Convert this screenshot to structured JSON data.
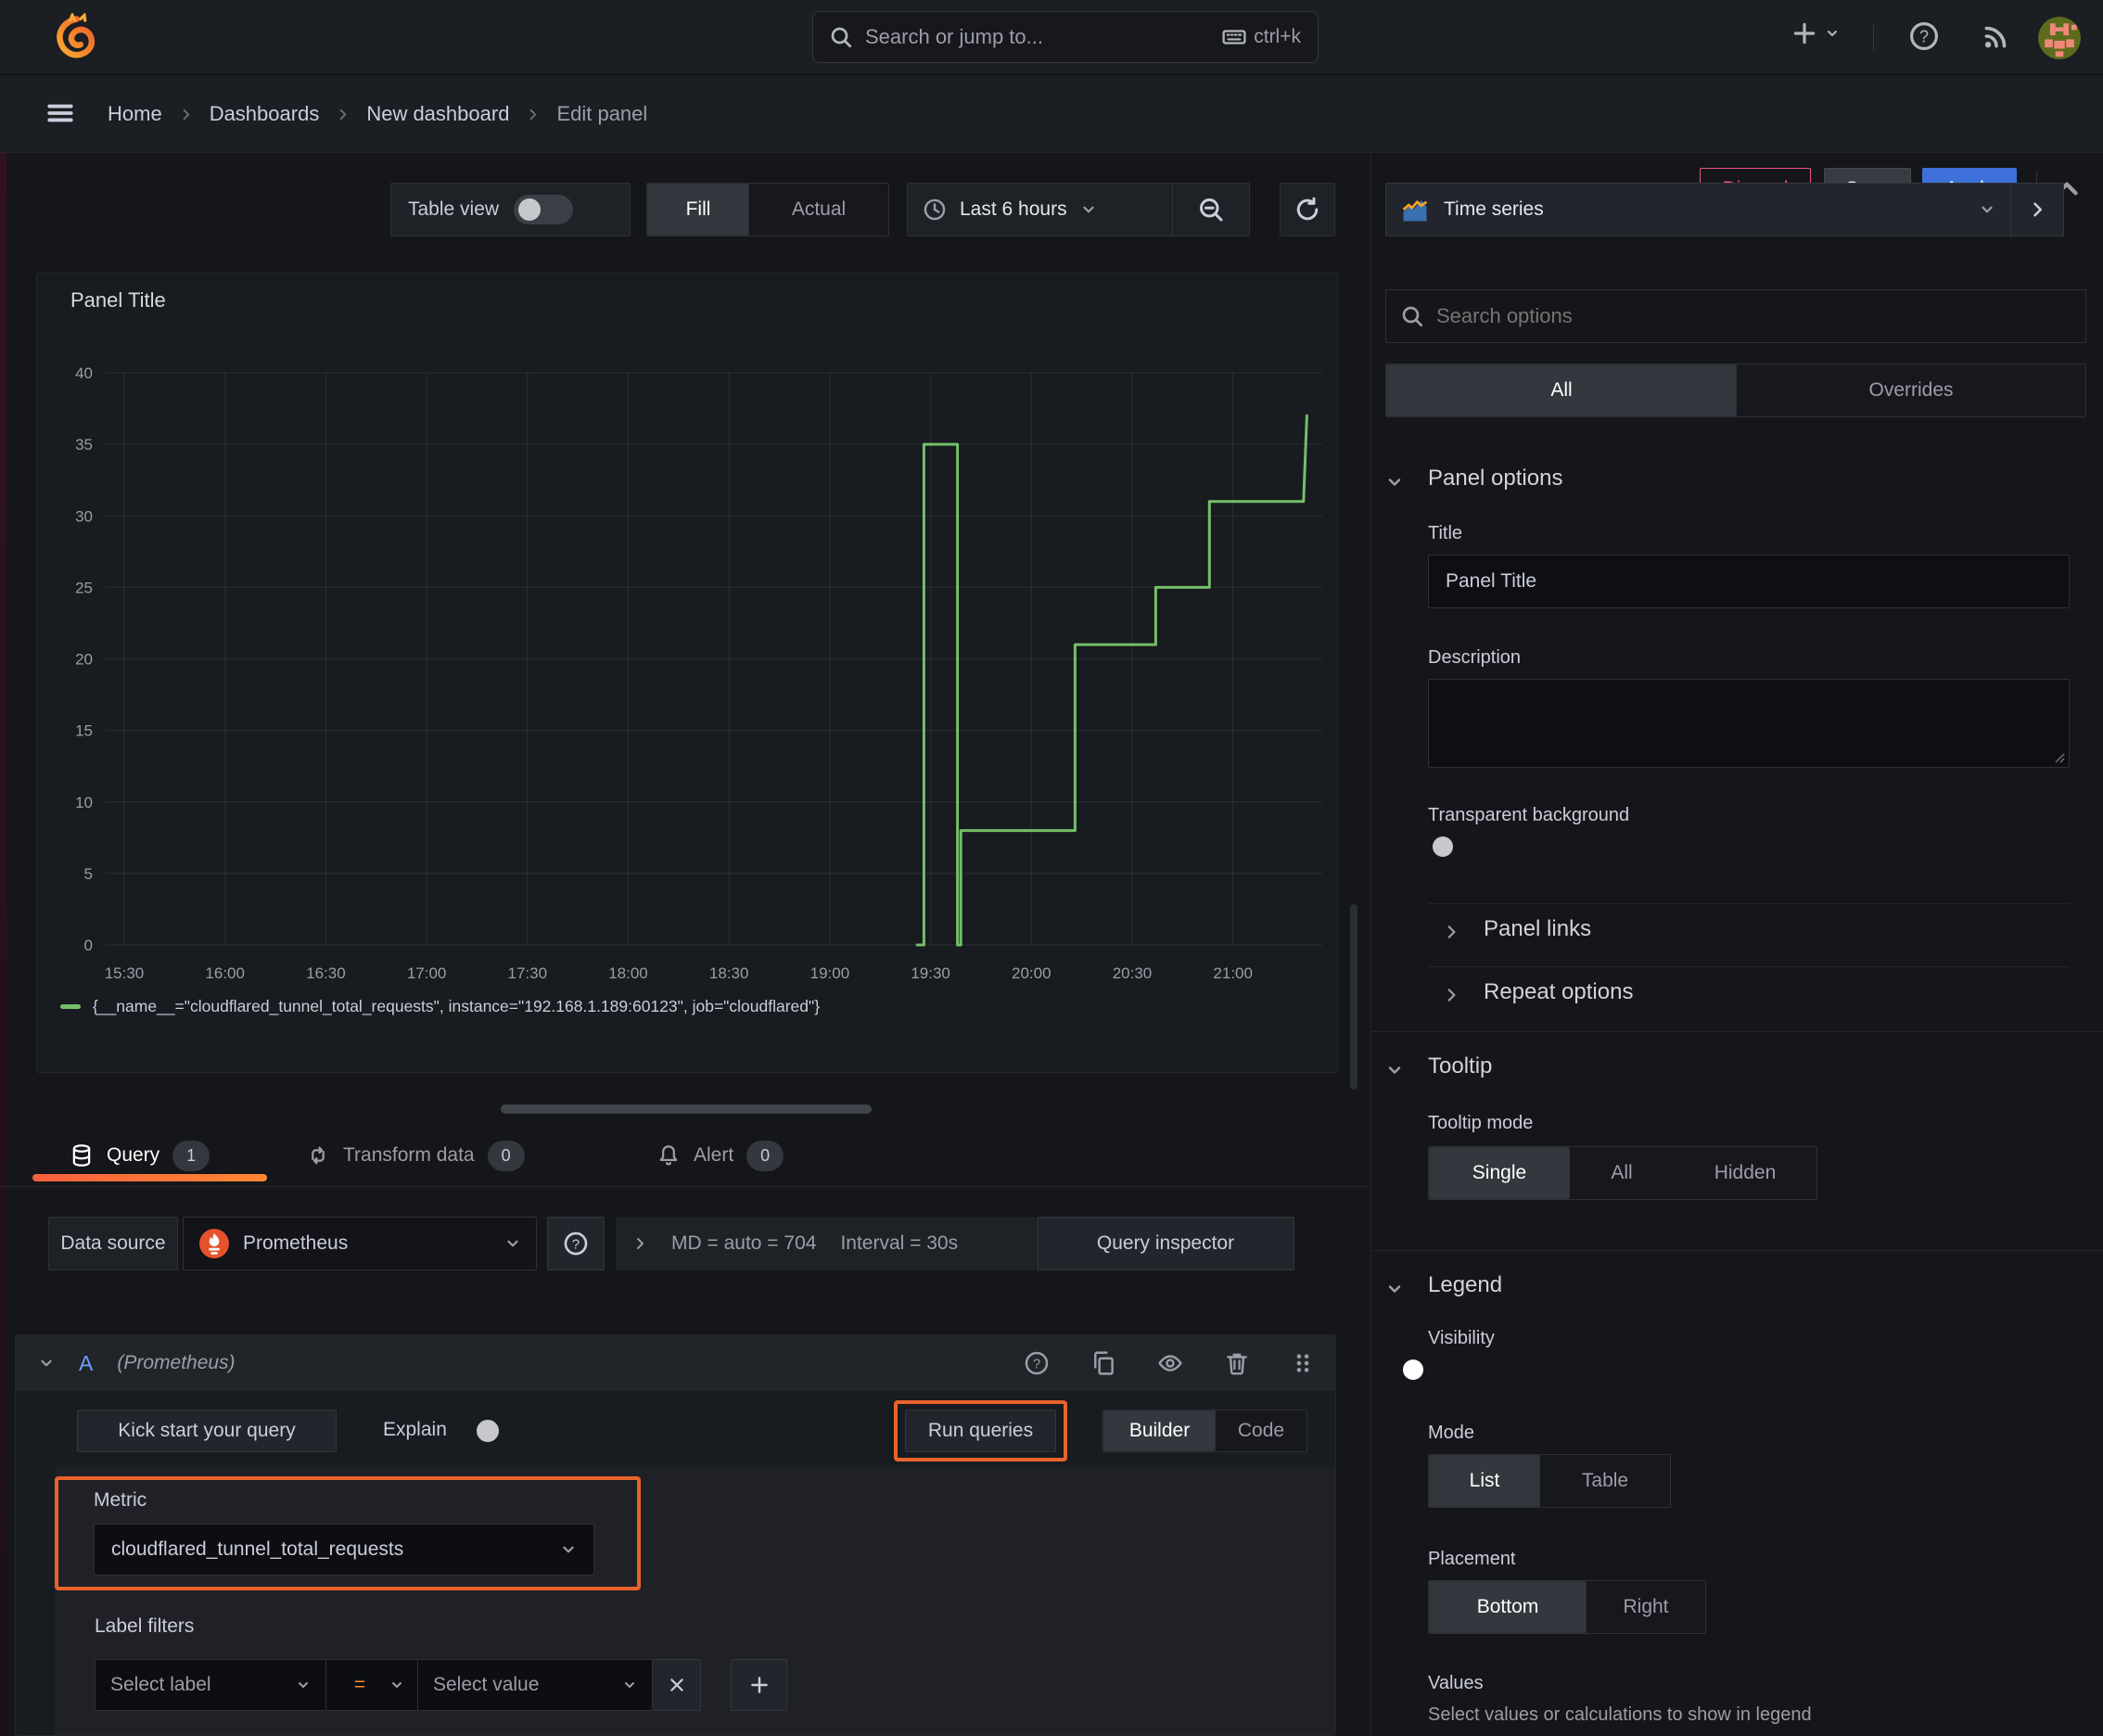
{
  "colors": {
    "accent_orange": "#e8632b",
    "tab_underline_from": "#f55f3e",
    "tab_underline_to": "#ff8833",
    "apply_blue": "#3d71d9",
    "discard_pink": "#f0517f",
    "series_green": "#73bf69",
    "toggle_on_blue": "#3d71d9"
  },
  "nav": {
    "search_placeholder": "Search or jump to...",
    "shortcut": "ctrl+k"
  },
  "breadcrumb": {
    "items": [
      "Home",
      "Dashboards",
      "New dashboard",
      "Edit panel"
    ]
  },
  "actions": {
    "discard": "Discard",
    "save": "Save",
    "apply": "Apply"
  },
  "toolbar": {
    "table_view": "Table view",
    "fill": "Fill",
    "actual": "Actual",
    "time_range": "Last 6 hours"
  },
  "viz_picker": {
    "name": "Time series"
  },
  "panel": {
    "title": "Panel Title"
  },
  "chart_data": {
    "type": "line",
    "step": true,
    "title": "Panel Title",
    "x_ticks": [
      "15:30",
      "16:00",
      "16:30",
      "17:00",
      "17:30",
      "18:00",
      "18:30",
      "19:00",
      "19:30",
      "20:00",
      "20:30",
      "21:00"
    ],
    "y_ticks": [
      0,
      5,
      10,
      15,
      20,
      25,
      30,
      35,
      40
    ],
    "ylim": [
      0,
      40
    ],
    "grid": true,
    "legend_position": "bottom",
    "series": [
      {
        "name": "{__name__=\"cloudflared_tunnel_total_requests\", instance=\"192.168.1.189:60123\", job=\"cloudflared\"}",
        "color": "#73bf69",
        "points": [
          [
            "19:26",
            0
          ],
          [
            "19:28",
            0
          ],
          [
            "19:28",
            35
          ],
          [
            "19:38",
            35
          ],
          [
            "19:38",
            0
          ],
          [
            "19:39",
            0
          ],
          [
            "19:39",
            8
          ],
          [
            "20:13",
            8
          ],
          [
            "20:13",
            21
          ],
          [
            "20:37",
            21
          ],
          [
            "20:37",
            25
          ],
          [
            "20:53",
            25
          ],
          [
            "20:53",
            31
          ],
          [
            "21:21",
            31
          ],
          [
            "21:22",
            37
          ]
        ]
      }
    ]
  },
  "querybar": {
    "tabs": [
      {
        "label": "Query",
        "count": "1"
      },
      {
        "label": "Transform data",
        "count": "0"
      },
      {
        "label": "Alert",
        "count": "0"
      }
    ]
  },
  "datasource": {
    "label": "Data source",
    "name": "Prometheus",
    "stats_md": "MD = auto = 704",
    "stats_interval": "Interval = 30s",
    "inspector": "Query inspector"
  },
  "query": {
    "ref": "A",
    "ds": "(Prometheus)",
    "kickstart": "Kick start your query",
    "explain": "Explain",
    "run": "Run queries",
    "mode_builder": "Builder",
    "mode_code": "Code",
    "metric_label": "Metric",
    "metric": "cloudflared_tunnel_total_requests",
    "label_filters": "Label filters",
    "select_label": "Select label",
    "op": "=",
    "select_value": "Select value"
  },
  "options": {
    "search_placeholder": "Search options",
    "tab_all": "All",
    "tab_overrides": "Overrides",
    "panel_options": {
      "header": "Panel options",
      "title_label": "Title",
      "title_value": "Panel Title",
      "description_label": "Description",
      "transparent": "Transparent background"
    },
    "links": "Panel links",
    "repeat": "Repeat options",
    "tooltip": {
      "header": "Tooltip",
      "mode_label": "Tooltip mode",
      "modes": [
        "Single",
        "All",
        "Hidden"
      ],
      "selected": "Single"
    },
    "legend": {
      "header": "Legend",
      "visibility": "Visibility",
      "mode_label": "Mode",
      "modes": [
        "List",
        "Table"
      ],
      "selected_mode": "List",
      "placement_label": "Placement",
      "placements": [
        "Bottom",
        "Right"
      ],
      "selected_placement": "Bottom",
      "values_label": "Values",
      "values_hint": "Select values or calculations to show in legend"
    }
  }
}
